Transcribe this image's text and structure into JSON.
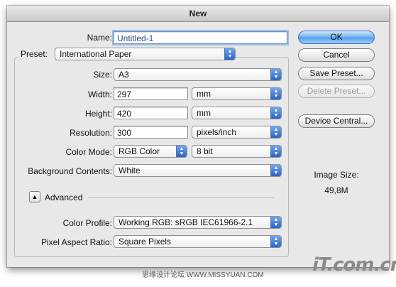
{
  "window": {
    "title": "New"
  },
  "form": {
    "name": {
      "label": "Name:",
      "value": "Untitled-1"
    },
    "preset": {
      "label": "Preset:",
      "value": "International Paper"
    },
    "size": {
      "label": "Size:",
      "value": "A3"
    },
    "width": {
      "label": "Width:",
      "value": "297",
      "unit": "mm"
    },
    "height": {
      "label": "Height:",
      "value": "420",
      "unit": "mm"
    },
    "resolution": {
      "label": "Resolution:",
      "value": "300",
      "unit": "pixels/inch"
    },
    "color_mode": {
      "label": "Color Mode:",
      "value": "RGB Color",
      "depth": "8 bit"
    },
    "background": {
      "label": "Background Contents:",
      "value": "White"
    },
    "advanced": {
      "label": "Advanced",
      "expanded": true
    },
    "color_profile": {
      "label": "Color Profile:",
      "value": "Working RGB:  sRGB IEC61966-2.1"
    },
    "pixel_aspect": {
      "label": "Pixel Aspect Ratio:",
      "value": "Square Pixels"
    }
  },
  "buttons": {
    "ok": "OK",
    "cancel": "Cancel",
    "save_preset": "Save Preset...",
    "delete_preset": "Delete Preset...",
    "device_central": "Device Central..."
  },
  "image_size": {
    "label": "Image Size:",
    "value": "49,8M"
  },
  "icons": {
    "popup_arrows": "updown-arrows-icon",
    "advanced_toggle": "disclosure-triangle-icon"
  },
  "watermark": {
    "text": "思缘设计论坛 WWW.MISSYUAN.COM",
    "logo": "iT.com.cn"
  },
  "colors": {
    "accent": "#4f9ceb",
    "focus": "#9dbfe6"
  }
}
